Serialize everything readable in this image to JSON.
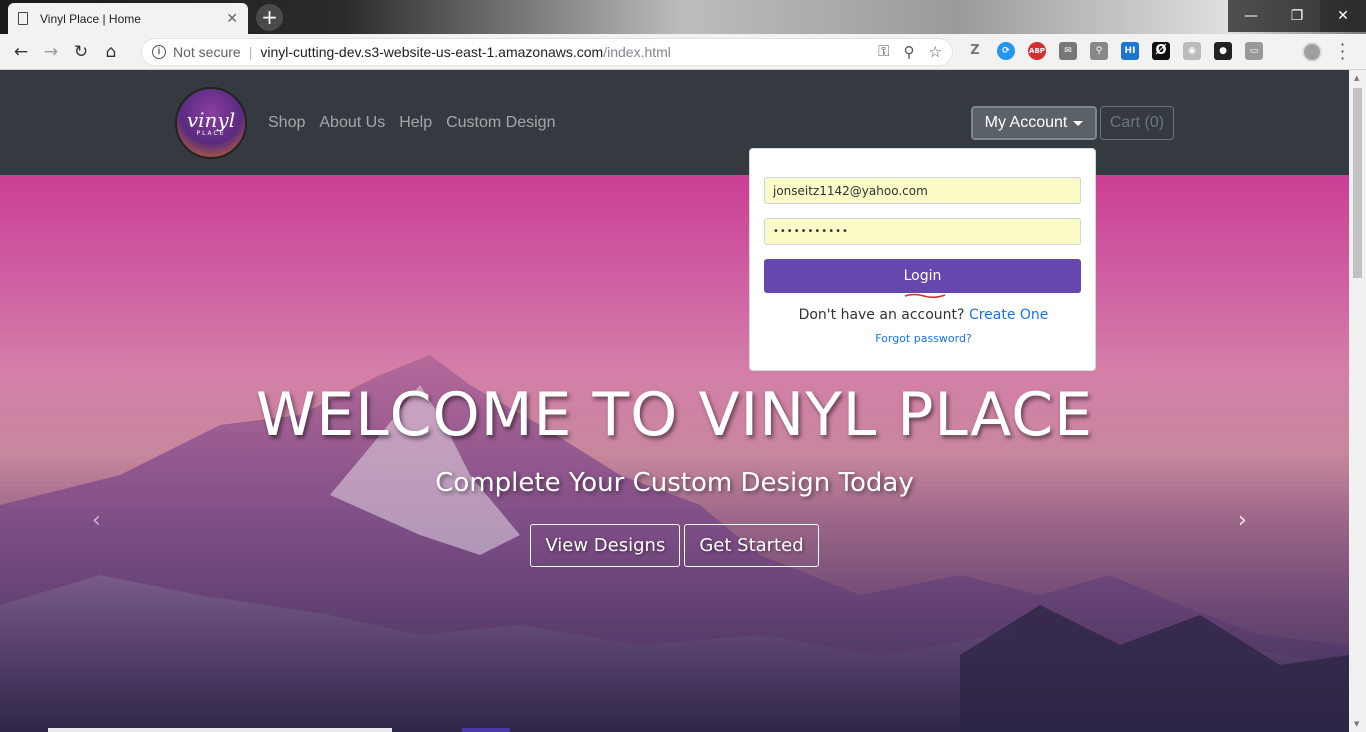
{
  "browser": {
    "tab_title": "Vinyl Place | Home",
    "tab_close": "✕",
    "new_tab": "+",
    "security_label": "Not secure",
    "url_host": "vinyl-cutting-dev.s3-website-us-east-1.amazonaws.com",
    "url_path": "/index.html",
    "extensions": [
      "Z",
      "⟳",
      "ABP",
      "✉",
      "⚲",
      "HI",
      "Ø",
      "◉",
      "●",
      "▭"
    ]
  },
  "site": {
    "logo_text": "vinyl",
    "logo_sub": "PLACE",
    "nav": [
      "Shop",
      "About Us",
      "Help",
      "Custom Design"
    ],
    "account_label": "My Account",
    "cart_label": "Cart (0)"
  },
  "login": {
    "email_value": "jonseitz1142@yahoo.com",
    "password_value": "•••••••••••",
    "login_label": "Login",
    "signup_prompt": "Don't have an account?",
    "signup_link": "Create One",
    "forgot_link": "Forgot password?"
  },
  "hero": {
    "title": "WELCOME TO VINYL PLACE",
    "subtitle": "Complete Your Custom Design Today",
    "btn_designs": "View Designs",
    "btn_start": "Get Started",
    "prev_arrow": "‹",
    "next_arrow": "›"
  },
  "colors": {
    "navbar": "#343a40",
    "login_button": "#6647b0",
    "link": "#1a73e8",
    "autofill": "#fafbc7"
  }
}
